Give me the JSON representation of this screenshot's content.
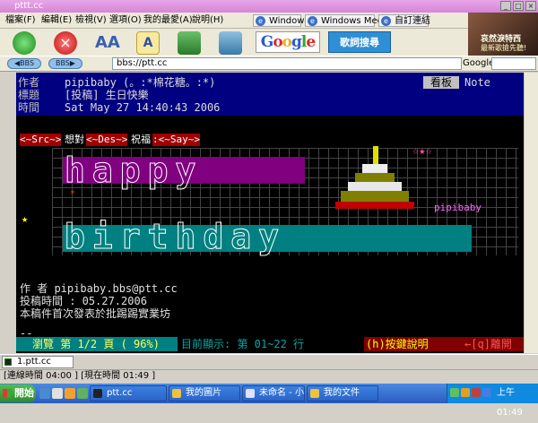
{
  "window": {
    "title": "pttt.cc"
  },
  "menu": {
    "items": [
      "檔案(F)",
      "編輯(E)",
      "檢視(V)",
      "選項(O)",
      "我的最愛(A)",
      "說明(H)"
    ],
    "links": [
      "Windows",
      "Windows Media",
      "自訂連結"
    ]
  },
  "toolbar": {
    "google_label": "Google",
    "lyrics_label": "歌詞搜尋"
  },
  "ad": {
    "line1": "哀然淚特西",
    "line2": "最新歌搶先聽!"
  },
  "address": {
    "value": "bbs://ptt.cc",
    "search_label": "Google"
  },
  "article": {
    "header": {
      "author_label": "作者",
      "author_value": "pipibaby (。:*棉花糖。:*)",
      "board_tag": "看板",
      "board_name": "Note",
      "title_label": "標題",
      "title_value": "[投稿] 生日快樂",
      "time_label": "時間",
      "time_value": "Sat May 27 14:40:43 2006"
    },
    "tags": {
      "src": "<~Src~>",
      "src_text": "想對",
      "des": "<~Des~>",
      "des_text": "祝福",
      "say": ":<~Say~>"
    },
    "art_text": {
      "line1": "happy",
      "line2": "birthday"
    },
    "art_signature": "pipibaby",
    "art_stars": "☆★☆",
    "body": [
      "作   者 pipibaby.bbs@ptt.cc",
      "投稿時間 : 05.27.2006",
      "本稿件首次發表於批踢踢實業坊"
    ],
    "dashes": "--"
  },
  "term_status": {
    "browse": "瀏覽 第 1/2 頁 ( 96%)",
    "showing": "目前顯示: 第 01~22 行",
    "help": "(h)按鍵說明",
    "exit": "←[q]離開"
  },
  "tabs": [
    {
      "label": "1.ptt.cc"
    }
  ],
  "statusbar": {
    "text": "[連線時間 04:00 ] [現在時間 01:49 ]"
  },
  "taskbar": {
    "start_label": "開始",
    "tasks": [
      "ptt.cc",
      "我的圖片",
      "未命名 - 小...",
      "我的文件"
    ],
    "clock": "上午 01:49"
  }
}
